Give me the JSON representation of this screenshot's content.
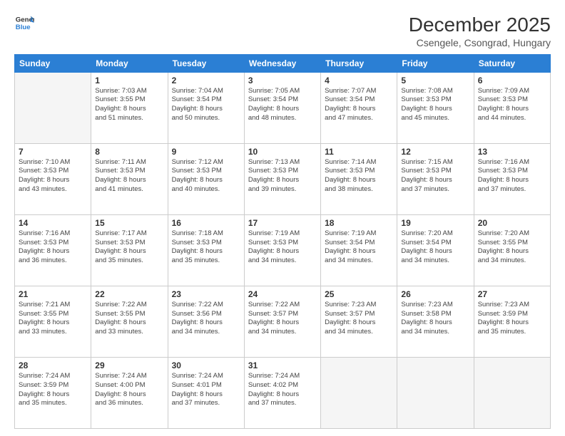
{
  "logo": {
    "line1": "General",
    "line2": "Blue"
  },
  "title": "December 2025",
  "subtitle": "Csengele, Csongrad, Hungary",
  "header_days": [
    "Sunday",
    "Monday",
    "Tuesday",
    "Wednesday",
    "Thursday",
    "Friday",
    "Saturday"
  ],
  "weeks": [
    [
      {
        "day": "",
        "info": ""
      },
      {
        "day": "1",
        "info": "Sunrise: 7:03 AM\nSunset: 3:55 PM\nDaylight: 8 hours\nand 51 minutes."
      },
      {
        "day": "2",
        "info": "Sunrise: 7:04 AM\nSunset: 3:54 PM\nDaylight: 8 hours\nand 50 minutes."
      },
      {
        "day": "3",
        "info": "Sunrise: 7:05 AM\nSunset: 3:54 PM\nDaylight: 8 hours\nand 48 minutes."
      },
      {
        "day": "4",
        "info": "Sunrise: 7:07 AM\nSunset: 3:54 PM\nDaylight: 8 hours\nand 47 minutes."
      },
      {
        "day": "5",
        "info": "Sunrise: 7:08 AM\nSunset: 3:53 PM\nDaylight: 8 hours\nand 45 minutes."
      },
      {
        "day": "6",
        "info": "Sunrise: 7:09 AM\nSunset: 3:53 PM\nDaylight: 8 hours\nand 44 minutes."
      }
    ],
    [
      {
        "day": "7",
        "info": "Sunrise: 7:10 AM\nSunset: 3:53 PM\nDaylight: 8 hours\nand 43 minutes."
      },
      {
        "day": "8",
        "info": "Sunrise: 7:11 AM\nSunset: 3:53 PM\nDaylight: 8 hours\nand 41 minutes."
      },
      {
        "day": "9",
        "info": "Sunrise: 7:12 AM\nSunset: 3:53 PM\nDaylight: 8 hours\nand 40 minutes."
      },
      {
        "day": "10",
        "info": "Sunrise: 7:13 AM\nSunset: 3:53 PM\nDaylight: 8 hours\nand 39 minutes."
      },
      {
        "day": "11",
        "info": "Sunrise: 7:14 AM\nSunset: 3:53 PM\nDaylight: 8 hours\nand 38 minutes."
      },
      {
        "day": "12",
        "info": "Sunrise: 7:15 AM\nSunset: 3:53 PM\nDaylight: 8 hours\nand 37 minutes."
      },
      {
        "day": "13",
        "info": "Sunrise: 7:16 AM\nSunset: 3:53 PM\nDaylight: 8 hours\nand 37 minutes."
      }
    ],
    [
      {
        "day": "14",
        "info": "Sunrise: 7:16 AM\nSunset: 3:53 PM\nDaylight: 8 hours\nand 36 minutes."
      },
      {
        "day": "15",
        "info": "Sunrise: 7:17 AM\nSunset: 3:53 PM\nDaylight: 8 hours\nand 35 minutes."
      },
      {
        "day": "16",
        "info": "Sunrise: 7:18 AM\nSunset: 3:53 PM\nDaylight: 8 hours\nand 35 minutes."
      },
      {
        "day": "17",
        "info": "Sunrise: 7:19 AM\nSunset: 3:53 PM\nDaylight: 8 hours\nand 34 minutes."
      },
      {
        "day": "18",
        "info": "Sunrise: 7:19 AM\nSunset: 3:54 PM\nDaylight: 8 hours\nand 34 minutes."
      },
      {
        "day": "19",
        "info": "Sunrise: 7:20 AM\nSunset: 3:54 PM\nDaylight: 8 hours\nand 34 minutes."
      },
      {
        "day": "20",
        "info": "Sunrise: 7:20 AM\nSunset: 3:55 PM\nDaylight: 8 hours\nand 34 minutes."
      }
    ],
    [
      {
        "day": "21",
        "info": "Sunrise: 7:21 AM\nSunset: 3:55 PM\nDaylight: 8 hours\nand 33 minutes."
      },
      {
        "day": "22",
        "info": "Sunrise: 7:22 AM\nSunset: 3:55 PM\nDaylight: 8 hours\nand 33 minutes."
      },
      {
        "day": "23",
        "info": "Sunrise: 7:22 AM\nSunset: 3:56 PM\nDaylight: 8 hours\nand 34 minutes."
      },
      {
        "day": "24",
        "info": "Sunrise: 7:22 AM\nSunset: 3:57 PM\nDaylight: 8 hours\nand 34 minutes."
      },
      {
        "day": "25",
        "info": "Sunrise: 7:23 AM\nSunset: 3:57 PM\nDaylight: 8 hours\nand 34 minutes."
      },
      {
        "day": "26",
        "info": "Sunrise: 7:23 AM\nSunset: 3:58 PM\nDaylight: 8 hours\nand 34 minutes."
      },
      {
        "day": "27",
        "info": "Sunrise: 7:23 AM\nSunset: 3:59 PM\nDaylight: 8 hours\nand 35 minutes."
      }
    ],
    [
      {
        "day": "28",
        "info": "Sunrise: 7:24 AM\nSunset: 3:59 PM\nDaylight: 8 hours\nand 35 minutes."
      },
      {
        "day": "29",
        "info": "Sunrise: 7:24 AM\nSunset: 4:00 PM\nDaylight: 8 hours\nand 36 minutes."
      },
      {
        "day": "30",
        "info": "Sunrise: 7:24 AM\nSunset: 4:01 PM\nDaylight: 8 hours\nand 37 minutes."
      },
      {
        "day": "31",
        "info": "Sunrise: 7:24 AM\nSunset: 4:02 PM\nDaylight: 8 hours\nand 37 minutes."
      },
      {
        "day": "",
        "info": ""
      },
      {
        "day": "",
        "info": ""
      },
      {
        "day": "",
        "info": ""
      }
    ]
  ]
}
